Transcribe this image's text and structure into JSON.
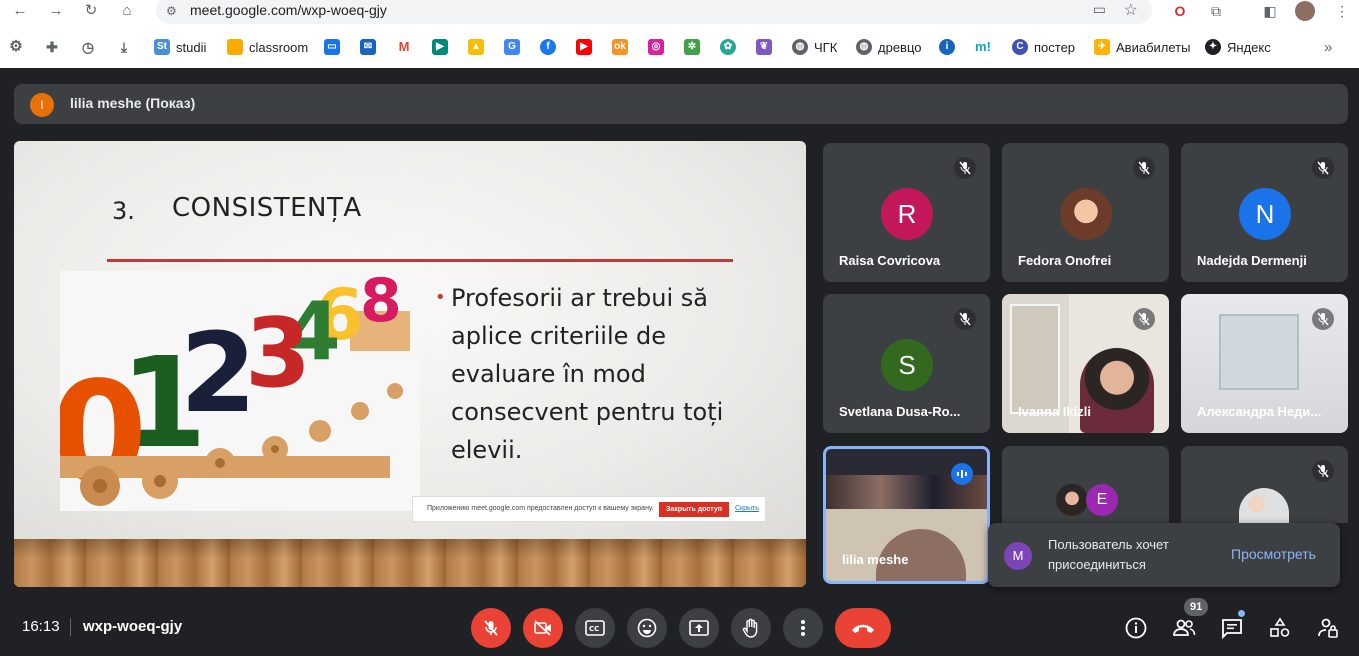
{
  "browser": {
    "url": "meet.google.com/wxp-woeq-gjy",
    "bookmarks": [
      "studii",
      "classroom",
      "ЧГК",
      "древцо",
      "постер",
      "Авиабилеты",
      "Яндекс"
    ]
  },
  "presenter_bar": {
    "avatar_letter": "l",
    "label": "lilia meshe (Показ)"
  },
  "slide": {
    "number": "3.",
    "title": "CONSISTENȚA",
    "bullet": "Profesorii ar trebui să aplice criteriile de evaluare în mod consecvent pentru toți elevii.",
    "share_notice": "Приложению meet.google.com предоставлен доступ к вашему экрану.",
    "stop_share": "Закрыть доступ",
    "hide": "Скрыть"
  },
  "participants": [
    {
      "name": "Raisa Covricova",
      "letter": "R",
      "color": "#c2185b"
    },
    {
      "name": "Fedora Onofrei",
      "letter": ""
    },
    {
      "name": "Nadejda Dermenji",
      "letter": "N",
      "color": "#1a73e8"
    },
    {
      "name": "Svetlana Dusa-Ro...",
      "letter": "S",
      "color": "#33691e"
    },
    {
      "name": "Ivanna Ikizli",
      "letter": ""
    },
    {
      "name": "Александра Неди...",
      "letter": ""
    },
    {
      "name": "lilia meshe",
      "letter": ""
    },
    {
      "name": "",
      "letter": "E",
      "color": "#9c27b0"
    },
    {
      "name": "",
      "letter": ""
    }
  ],
  "toast": {
    "avatar_letter": "M",
    "message": "Пользователь хочет присоединиться",
    "action": "Просмотреть"
  },
  "bottom": {
    "time": "16:13",
    "meeting_code": "wxp-woeq-gjy",
    "participant_count": "91"
  }
}
